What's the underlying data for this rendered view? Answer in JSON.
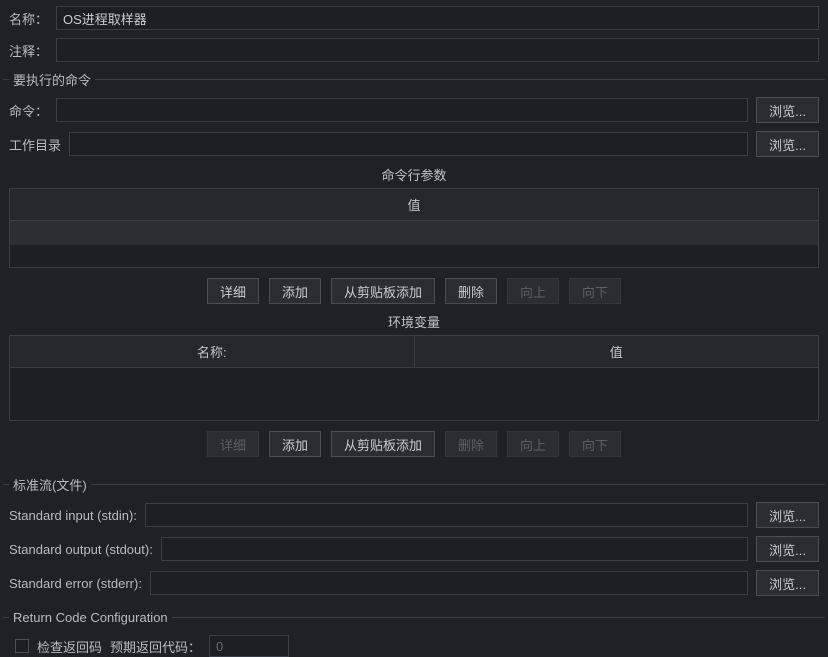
{
  "labels": {
    "name": "名称：",
    "comment": "注释：",
    "command": "命令：",
    "workdir": "工作目录",
    "stdin": "Standard input (stdin):",
    "stdout": "Standard output (stdout):",
    "stderr": "Standard error (stderr):",
    "checkReturn": "检查返回码",
    "expectedReturn": "预期返回代码："
  },
  "values": {
    "name": "OS进程取样器",
    "comment": "",
    "command": "",
    "workdir": "",
    "stdin": "",
    "stdout": "",
    "stderr": "",
    "expectedReturn": "0"
  },
  "buttons": {
    "browse": "浏览...",
    "detail": "详细",
    "add": "添加",
    "addFromClipboard": "从剪贴板添加",
    "delete": "删除",
    "up": "向上",
    "down": "向下"
  },
  "groups": {
    "commandToExec": "要执行的命令",
    "stdStreams": "标准流(文件)",
    "returnCode": "Return Code Configuration"
  },
  "section": {
    "cmdParams": "命令行参数",
    "envVars": "环境变量"
  },
  "tableHeaders": {
    "value": "值",
    "name": "名称:",
    "envValue": "值"
  }
}
